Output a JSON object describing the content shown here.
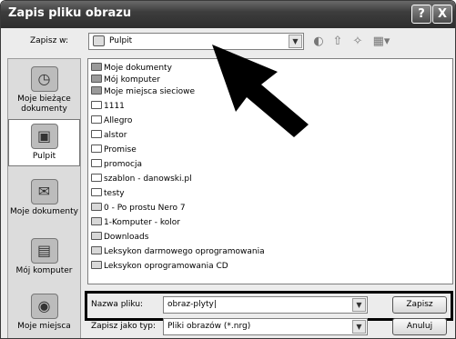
{
  "dialog": {
    "title": "Zapis pliku obrazu",
    "help_label": "?",
    "close_label": "X"
  },
  "toolbar": {
    "save_in_label": "Zapisz w:",
    "location": "Pulpit"
  },
  "places": [
    {
      "label": "Moje bieżące dokumenty",
      "icon": "recent-documents-icon"
    },
    {
      "label": "Pulpit",
      "icon": "desktop-icon",
      "selected": true
    },
    {
      "label": "Moje dokumenty",
      "icon": "my-documents-icon"
    },
    {
      "label": "Mój komputer",
      "icon": "my-computer-icon"
    },
    {
      "label": "Moje miejsca",
      "icon": "network-places-icon"
    }
  ],
  "files": [
    {
      "name": "Moje dokumenty",
      "kind": "special"
    },
    {
      "name": "Mój komputer",
      "kind": "special"
    },
    {
      "name": "Moje miejsca sieciowe",
      "kind": "special"
    },
    {
      "name": "1111",
      "kind": "folder"
    },
    {
      "name": "Allegro",
      "kind": "folder"
    },
    {
      "name": "alstor",
      "kind": "folder"
    },
    {
      "name": "Promise",
      "kind": "folder"
    },
    {
      "name": "promocja",
      "kind": "folder"
    },
    {
      "name": "szablon - danowski.pl",
      "kind": "folder"
    },
    {
      "name": "testy",
      "kind": "folder"
    },
    {
      "name": "0 - Po prostu Nero 7",
      "kind": "shortcut"
    },
    {
      "name": "1-Komputer - kolor",
      "kind": "shortcut"
    },
    {
      "name": "Downloads",
      "kind": "shortcut"
    },
    {
      "name": "Leksykon darmowego oprogramowania",
      "kind": "shortcut"
    },
    {
      "name": "Leksykon oprogramowania CD",
      "kind": "shortcut"
    }
  ],
  "form": {
    "filename_label": "Nazwa pliku:",
    "filename_value": "obraz-plyty",
    "filetype_label": "Zapisz jako typ:",
    "filetype_value": "Pliki obrazów (*.nrg)",
    "save_button": "Zapisz",
    "cancel_button": "Anuluj"
  },
  "colors": {
    "annotation": "#000000"
  }
}
